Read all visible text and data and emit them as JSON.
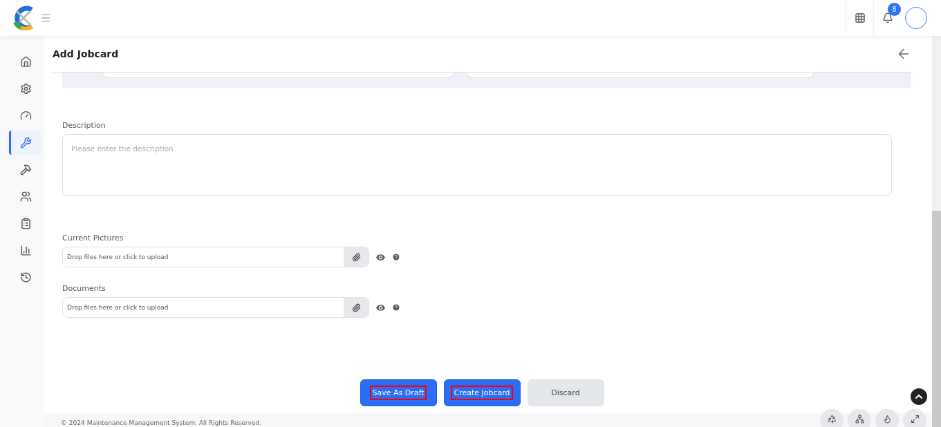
{
  "header": {
    "notifications": {
      "count": "8"
    }
  },
  "sidebar": {
    "items": [
      {
        "selected": false
      },
      {
        "selected": false
      },
      {
        "selected": false
      },
      {
        "selected": true
      },
      {
        "selected": false
      },
      {
        "selected": false
      },
      {
        "selected": false
      },
      {
        "selected": false
      },
      {
        "selected": false
      }
    ]
  },
  "page": {
    "title": "Add Jobcard"
  },
  "description": {
    "label": "Description",
    "placeholder": "Please enter the description"
  },
  "uploads": [
    {
      "label": "Current Pictures",
      "placeholder": "Drop files here or click to upload"
    },
    {
      "label": "Documents",
      "placeholder": "Drop files here or click to upload"
    }
  ],
  "buttons": [
    {
      "label": "Save As Draft",
      "kind": "primary",
      "highlighted": true
    },
    {
      "label": "Create Jobcard",
      "kind": "primary",
      "highlighted": true
    },
    {
      "label": "Discard",
      "kind": "secondary",
      "highlighted": false
    }
  ],
  "footer": {
    "text": "© 2024 Maintenance Management System. All Rights Reserved."
  }
}
